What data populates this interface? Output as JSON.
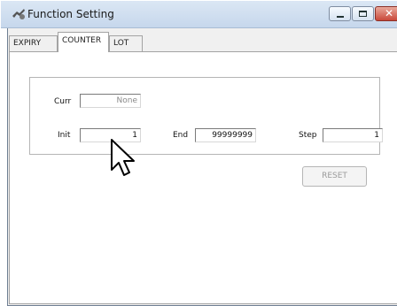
{
  "window": {
    "title": "Function Setting"
  },
  "tabs": [
    {
      "label": "EXPIRY"
    },
    {
      "label": "COUNTER"
    },
    {
      "label": "LOT"
    }
  ],
  "active_tab": "COUNTER",
  "counter": {
    "curr_label": "Curr",
    "curr_value": "None",
    "init_label": "Init",
    "init_value": "1",
    "end_label": "End",
    "end_value": "99999999",
    "step_label": "Step",
    "step_value": "1",
    "reset_label": "RESET"
  },
  "icons": [
    "app-icon",
    "minimize-icon",
    "maximize-icon",
    "close-icon",
    "mouse-cursor-icon"
  ]
}
